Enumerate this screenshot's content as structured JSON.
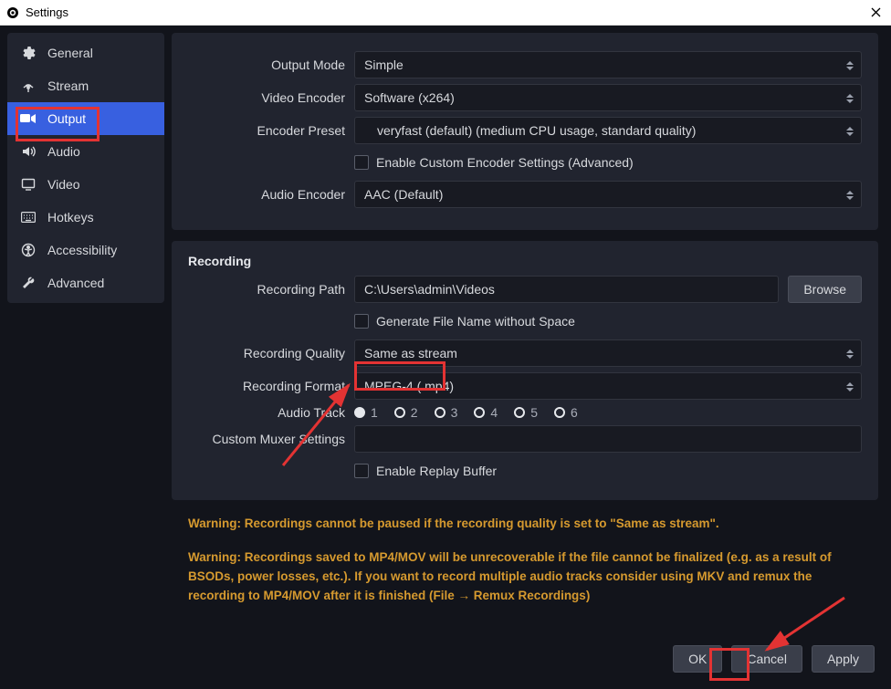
{
  "window": {
    "title": "Settings"
  },
  "sidebar": {
    "items": [
      {
        "label": "General"
      },
      {
        "label": "Stream"
      },
      {
        "label": "Output"
      },
      {
        "label": "Audio"
      },
      {
        "label": "Video"
      },
      {
        "label": "Hotkeys"
      },
      {
        "label": "Accessibility"
      },
      {
        "label": "Advanced"
      }
    ],
    "active_index": 2
  },
  "streaming": {
    "output_mode": {
      "label": "Output Mode",
      "value": "Simple"
    },
    "video_encoder": {
      "label": "Video Encoder",
      "value": "Software (x264)"
    },
    "encoder_preset": {
      "label": "Encoder Preset",
      "value": "veryfast (default) (medium CPU usage, standard quality)"
    },
    "enable_custom": {
      "label": "Enable Custom Encoder Settings (Advanced)",
      "checked": false
    },
    "audio_encoder": {
      "label": "Audio Encoder",
      "value": "AAC (Default)"
    }
  },
  "recording": {
    "title": "Recording",
    "path": {
      "label": "Recording Path",
      "value": "C:\\Users\\admin\\Videos",
      "browse": "Browse"
    },
    "gen_no_space": {
      "label": "Generate File Name without Space",
      "checked": false
    },
    "quality": {
      "label": "Recording Quality",
      "value": "Same as stream"
    },
    "format": {
      "label": "Recording Format",
      "value": "MPEG-4 (.mp4)"
    },
    "audio_track": {
      "label": "Audio Track",
      "options": [
        "1",
        "2",
        "3",
        "4",
        "5",
        "6"
      ],
      "selected": "1"
    },
    "muxer": {
      "label": "Custom Muxer Settings",
      "value": ""
    },
    "replay_buffer": {
      "label": "Enable Replay Buffer",
      "checked": false
    }
  },
  "warnings": {
    "w1": "Warning: Recordings cannot be paused if the recording quality is set to \"Same as stream\".",
    "w2": "Warning: Recordings saved to MP4/MOV will be unrecoverable if the file cannot be finalized (e.g. as a result of BSODs, power losses, etc.). If you want to record multiple audio tracks consider using MKV and remux the recording to MP4/MOV after it is finished (File → Remux Recordings)"
  },
  "footer": {
    "ok": "OK",
    "cancel": "Cancel",
    "apply": "Apply"
  }
}
